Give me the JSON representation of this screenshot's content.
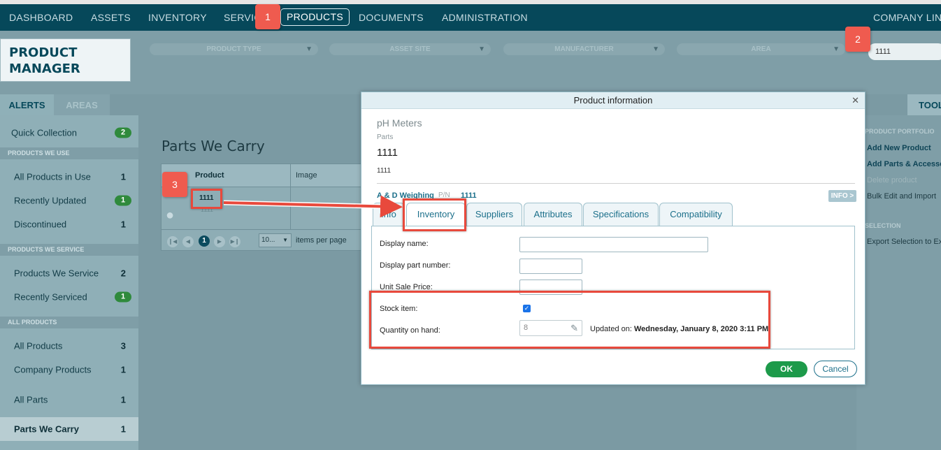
{
  "nav": {
    "items": [
      "DASHBOARD",
      "ASSETS",
      "INVENTORY",
      "SERVIC",
      "PRODUCTS",
      "DOCUMENTS",
      "ADMINISTRATION"
    ],
    "right": "COMPANY LINK"
  },
  "header": {
    "title_line1": "PRODUCT",
    "title_line2": "MANAGER",
    "filters": [
      "PRODUCT TYPE",
      "ASSET SITE",
      "MANUFACTURER",
      "AREA"
    ],
    "search_value": "1111"
  },
  "sidebar": {
    "tab_alerts": "ALERTS",
    "tab_areas": "AREAS",
    "quick_collection": {
      "label": "Quick Collection",
      "badge": "2"
    },
    "section_use": "PRODUCTS WE USE",
    "all_in_use": {
      "label": "All Products in Use",
      "count": "1"
    },
    "recently_updated": {
      "label": "Recently Updated",
      "badge": "1"
    },
    "discontinued": {
      "label": "Discontinued",
      "count": "1"
    },
    "section_service": "PRODUCTS WE SERVICE",
    "we_service": {
      "label": "Products We Service",
      "count": "2"
    },
    "recently_serviced": {
      "label": "Recently Serviced",
      "badge": "1"
    },
    "section_all": "ALL PRODUCTS",
    "all_products": {
      "label": "All Products",
      "count": "3"
    },
    "company_products": {
      "label": "Company Products",
      "count": "1"
    },
    "all_parts": {
      "label": "All Parts",
      "count": "1"
    },
    "parts_we_carry": {
      "label": "Parts We Carry",
      "count": "1"
    }
  },
  "main": {
    "title": "Parts We Carry",
    "grid": {
      "col_product": "Product",
      "col_image": "Image",
      "row_product": "1111",
      "row_sub": "1111"
    },
    "pager": {
      "current": "1",
      "page_size": "10...",
      "label": "items per page"
    }
  },
  "tools": {
    "tab": "TOOL",
    "section_portfolio": "PRODUCT PORTFOLIO",
    "add_new": "Add New Product",
    "add_parts": "Add Parts & Accessor",
    "delete": "Delete product",
    "bulk": "Bulk Edit and Import",
    "section_selection": "SELECTION",
    "export": "Export Selection to Ex"
  },
  "modal": {
    "title": "Product information",
    "category": "pH Meters",
    "sub": "Parts",
    "name": "1111",
    "small": "1111",
    "manufacturer": "A & D Weighing",
    "pn_label": "P/N",
    "pn_value": "1111",
    "info_button": "INFO >",
    "tabs": [
      "Info",
      "Inventory",
      "Suppliers",
      "Attributes",
      "Specifications",
      "Compatibility"
    ],
    "fields": {
      "display_name": "Display name:",
      "display_part": "Display part number:",
      "unit_price": "Unit Sale Price:",
      "stock_item": "Stock item:",
      "quantity": "Quantity on hand:",
      "quantity_value": "8",
      "updated_label": "Updated on:",
      "updated_value": "Wednesday, January 8, 2020 3:11 PM"
    },
    "ok": "OK",
    "cancel": "Cancel"
  },
  "annotations": {
    "step1": "1",
    "step2": "2",
    "step3": "3"
  }
}
